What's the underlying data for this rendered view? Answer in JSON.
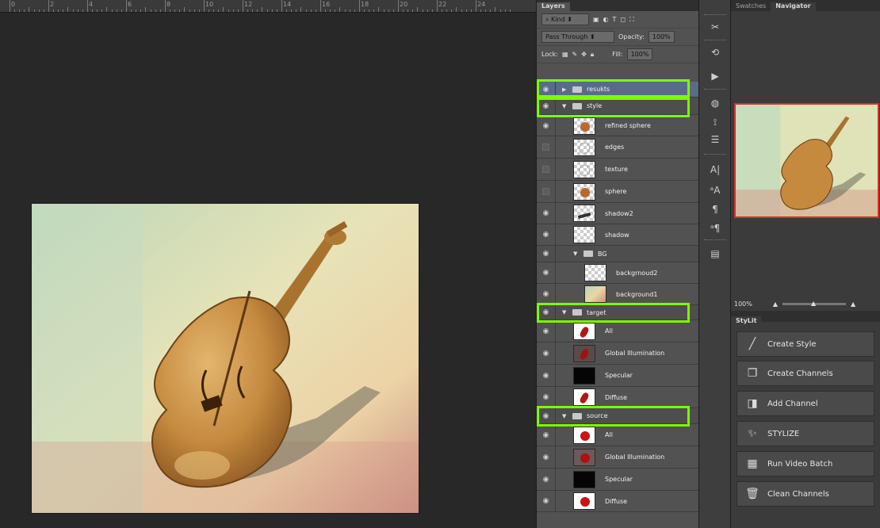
{
  "ruler": {
    "labels": [
      "0",
      "2",
      "4",
      "6",
      "8",
      "10",
      "12",
      "14",
      "16",
      "18",
      "20",
      "22",
      "24"
    ]
  },
  "layers_panel": {
    "tab": "Layers",
    "kind_label": "Kind",
    "filter_icons": [
      "T",
      "◻",
      "⛶"
    ],
    "blend_mode": "Pass Through",
    "opacity_label": "Opacity:",
    "opacity_value": "100%",
    "lock_label": "Lock:",
    "fill_label": "Fill:",
    "fill_value": "100%",
    "layers": [
      {
        "name": "resukts",
        "type": "group",
        "collapsed": true,
        "visible": true
      },
      {
        "name": "style",
        "type": "group",
        "collapsed": false,
        "visible": true
      },
      {
        "name": "refined sphere",
        "type": "layer",
        "visible": true
      },
      {
        "name": "edges",
        "type": "layer",
        "visible": false
      },
      {
        "name": "texture",
        "type": "layer",
        "visible": false
      },
      {
        "name": "sphere",
        "type": "layer",
        "visible": false
      },
      {
        "name": "shadow2",
        "type": "layer",
        "visible": true
      },
      {
        "name": "shadow",
        "type": "layer",
        "visible": true
      },
      {
        "name": "BG",
        "type": "group",
        "collapsed": false,
        "visible": true
      },
      {
        "name": "backgrnoud2",
        "type": "layer",
        "visible": true
      },
      {
        "name": "background1",
        "type": "layer",
        "visible": true
      },
      {
        "name": "target",
        "type": "group",
        "collapsed": false,
        "visible": true
      },
      {
        "name": "All",
        "type": "layer",
        "visible": true
      },
      {
        "name": "Global Illumination",
        "type": "layer",
        "visible": true
      },
      {
        "name": "Specular",
        "type": "layer",
        "visible": true
      },
      {
        "name": "Diffuse",
        "type": "layer",
        "visible": true
      },
      {
        "name": "source",
        "type": "group",
        "collapsed": false,
        "visible": true
      },
      {
        "name": "All",
        "type": "layer",
        "visible": true
      },
      {
        "name": "Global Illumination",
        "type": "layer",
        "visible": true
      },
      {
        "name": "Specular",
        "type": "layer",
        "visible": true
      },
      {
        "name": "Diffuse",
        "type": "layer",
        "visible": true
      }
    ]
  },
  "right_panel": {
    "tabs": [
      "Swatches",
      "Navigator"
    ],
    "zoom": "100%",
    "stylit_tab": "StyLit",
    "buttons": [
      "Create Style",
      "Create Channels",
      "Add Channel",
      "STYLIZE",
      "Run Video Batch",
      "Clean Channels"
    ]
  },
  "colors": {
    "highlight": "#7cfc00",
    "navigator_border": "#d53030"
  }
}
